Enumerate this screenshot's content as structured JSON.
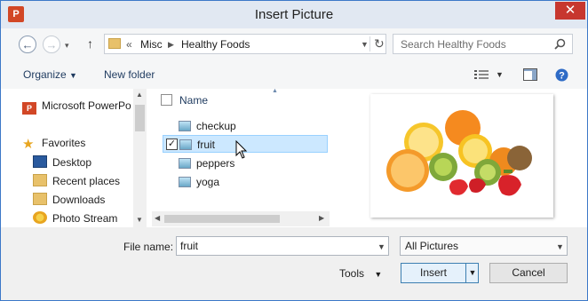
{
  "window": {
    "title": "Insert Picture",
    "app_icon": "P",
    "close_glyph": "✕"
  },
  "nav": {
    "back_glyph": "←",
    "forward_glyph": "→",
    "up_glyph": "↑",
    "breadcrumb_prefix": "«",
    "breadcrumb": [
      "Misc",
      "Healthy Foods"
    ],
    "refresh_glyph": "↻",
    "search_placeholder": "Search Healthy Foods"
  },
  "toolbar": {
    "organize": "Organize",
    "new_folder": "New folder"
  },
  "sidebar": {
    "items": [
      {
        "label": "Microsoft PowerPo",
        "icon": "powerpoint-icon"
      },
      {
        "label": "Favorites",
        "icon": "star-icon"
      },
      {
        "label": "Desktop",
        "icon": "desktop-icon"
      },
      {
        "label": "Recent places",
        "icon": "recent-places-icon"
      },
      {
        "label": "Downloads",
        "icon": "downloads-icon"
      },
      {
        "label": "Photo Stream",
        "icon": "photo-stream-icon"
      }
    ]
  },
  "files": {
    "column_name": "Name",
    "items": [
      {
        "name": "checkup",
        "selected": false
      },
      {
        "name": "fruit",
        "selected": true
      },
      {
        "name": "peppers",
        "selected": false
      },
      {
        "name": "yoga",
        "selected": false
      }
    ]
  },
  "footer": {
    "file_name_label": "File name:",
    "file_name_value": "fruit",
    "filter_value": "All Pictures",
    "tools": "Tools",
    "insert": "Insert",
    "cancel": "Cancel"
  },
  "colors": {
    "selection": "#cce8ff",
    "close": "#c7372f",
    "accent": "#3c78c8"
  }
}
